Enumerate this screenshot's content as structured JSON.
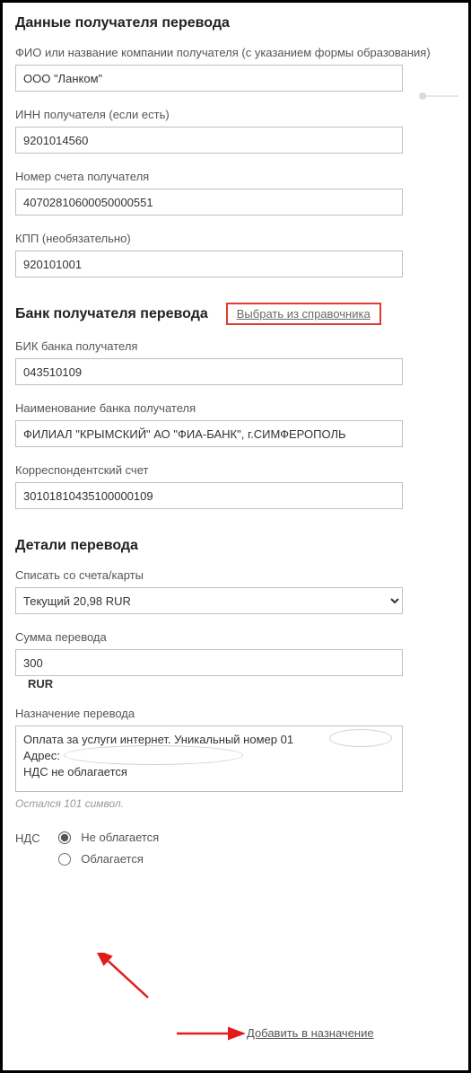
{
  "recipient": {
    "section_title": "Данные получателя перевода",
    "name_label": "ФИО или название компании получателя (с указанием формы образования)",
    "name_value": "ООО \"Ланком\"",
    "inn_label": "ИНН получателя (если есть)",
    "inn_value": "9201014560",
    "account_label": "Номер счета получателя",
    "account_value": "40702810600050000551",
    "kpp_label": "КПП (необязательно)",
    "kpp_value": "920101001"
  },
  "bank": {
    "section_title": "Банк получателя перевода",
    "directory_link": "Выбрать из справочника",
    "bic_label": "БИК банка получателя",
    "bic_value": "043510109",
    "name_label": "Наименование банка получателя",
    "name_value": "ФИЛИАЛ \"КРЫМСКИЙ\" АО \"ФИА-БАНК\", г.СИМФЕРОПОЛЬ",
    "corr_label": "Корреспондентский счет",
    "corr_value": "30101810435100000109"
  },
  "details": {
    "section_title": "Детали перевода",
    "debit_label": "Списать со счета/карты",
    "debit_value": "Текущий 20,98 RUR",
    "amount_label": "Сумма перевода",
    "amount_value": "300",
    "currency": "RUR",
    "purpose_label": "Назначение перевода",
    "purpose_value": "Оплата за услуги интернет. Уникальный номер 01\nАдрес:\nНДС не облагается",
    "remaining_note": "Остался 101 символ."
  },
  "nds": {
    "label": "НДС",
    "option_no": "Не облагается",
    "option_yes": "Облагается",
    "add_link": "Добавить в назначение"
  }
}
